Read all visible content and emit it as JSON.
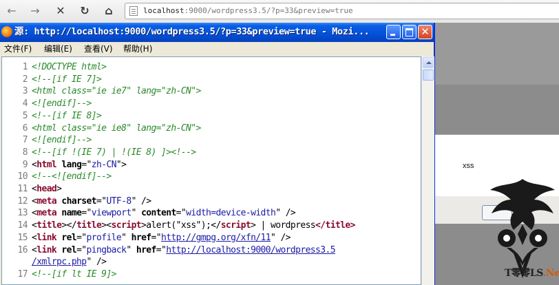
{
  "browser": {
    "url_host": "localhost",
    "url_rest": ":9000/wordpress3.5/?p=33&preview=true"
  },
  "source_window": {
    "title": "源: http://localhost:9000/wordpress3.5/?p=33&preview=true - Mozi...",
    "menu": [
      "文件(F)",
      "编辑(E)",
      "查看(V)",
      "帮助(H)"
    ]
  },
  "source_lines": [
    [
      {
        "c": "cm",
        "t": "<!DOCTYPE html>"
      }
    ],
    [
      {
        "c": "cm",
        "t": "<!--[if IE 7]>"
      }
    ],
    [
      {
        "c": "cm",
        "t": "<html class=\"ie ie7\" lang=\"zh-CN\">"
      }
    ],
    [
      {
        "c": "cm",
        "t": "<![endif]-->"
      }
    ],
    [
      {
        "c": "cm",
        "t": "<!--[if IE 8]>"
      }
    ],
    [
      {
        "c": "cm",
        "t": "<html class=\"ie ie8\" lang=\"zh-CN\">"
      }
    ],
    [
      {
        "c": "cm",
        "t": "<![endif]-->"
      }
    ],
    [
      {
        "c": "cm",
        "t": "<!--[if !(IE 7) | !(IE 8)  ]><!-->"
      }
    ],
    [
      {
        "c": "tg",
        "t": "<"
      },
      {
        "c": "tn",
        "t": "html"
      },
      {
        "c": "tx",
        "t": " "
      },
      {
        "c": "an",
        "t": "lang"
      },
      {
        "c": "tx",
        "t": "=\""
      },
      {
        "c": "av",
        "t": "zh-CN"
      },
      {
        "c": "tx",
        "t": "\">"
      }
    ],
    [
      {
        "c": "cm",
        "t": "<!--<![endif]-->"
      }
    ],
    [
      {
        "c": "tg",
        "t": "<"
      },
      {
        "c": "tn",
        "t": "head"
      },
      {
        "c": "tg",
        "t": ">"
      }
    ],
    [
      {
        "c": "tg",
        "t": "<"
      },
      {
        "c": "tn",
        "t": "meta"
      },
      {
        "c": "tx",
        "t": " "
      },
      {
        "c": "an",
        "t": "charset"
      },
      {
        "c": "tx",
        "t": "=\""
      },
      {
        "c": "av",
        "t": "UTF-8"
      },
      {
        "c": "tx",
        "t": "\" />"
      }
    ],
    [
      {
        "c": "tg",
        "t": "<"
      },
      {
        "c": "tn",
        "t": "meta"
      },
      {
        "c": "tx",
        "t": " "
      },
      {
        "c": "an",
        "t": "name"
      },
      {
        "c": "tx",
        "t": "=\""
      },
      {
        "c": "av",
        "t": "viewport"
      },
      {
        "c": "tx",
        "t": "\" "
      },
      {
        "c": "an",
        "t": "content"
      },
      {
        "c": "tx",
        "t": "=\""
      },
      {
        "c": "av",
        "t": "width=device-width"
      },
      {
        "c": "tx",
        "t": "\" />"
      }
    ],
    [
      {
        "c": "tg",
        "t": "<"
      },
      {
        "c": "tn",
        "t": "title"
      },
      {
        "c": "tg",
        "t": "></"
      },
      {
        "c": "tn",
        "t": "title"
      },
      {
        "c": "tg",
        "t": "><"
      },
      {
        "c": "tn",
        "t": "script"
      },
      {
        "c": "tg",
        "t": ">"
      },
      {
        "c": "tx",
        "t": "alert(\"xss\");"
      },
      {
        "c": "tg",
        "t": "</"
      },
      {
        "c": "tn",
        "t": "script"
      },
      {
        "c": "tg",
        "t": ">"
      },
      {
        "c": "tx",
        "t": " | wordpress"
      },
      {
        "c": "tn",
        "t": "</title>"
      }
    ],
    [
      {
        "c": "tg",
        "t": "<"
      },
      {
        "c": "tn",
        "t": "link"
      },
      {
        "c": "tx",
        "t": " "
      },
      {
        "c": "an",
        "t": "rel"
      },
      {
        "c": "tx",
        "t": "=\""
      },
      {
        "c": "av",
        "t": "profile"
      },
      {
        "c": "tx",
        "t": "\" "
      },
      {
        "c": "an",
        "t": "href"
      },
      {
        "c": "tx",
        "t": "=\""
      },
      {
        "c": "lk",
        "t": "http://gmpg.org/xfn/11"
      },
      {
        "c": "tx",
        "t": "\" />"
      }
    ],
    [
      {
        "c": "tg",
        "t": "<"
      },
      {
        "c": "tn",
        "t": "link"
      },
      {
        "c": "tx",
        "t": " "
      },
      {
        "c": "an",
        "t": "rel"
      },
      {
        "c": "tx",
        "t": "=\""
      },
      {
        "c": "av",
        "t": "pingback"
      },
      {
        "c": "tx",
        "t": "\" "
      },
      {
        "c": "an",
        "t": "href"
      },
      {
        "c": "tx",
        "t": "=\""
      },
      {
        "c": "lk",
        "t": "http://localhost:9000/wordpress3.5"
      }
    ],
    [
      {
        "c": "lk",
        "t": "/xmlrpc.php"
      },
      {
        "c": "tx",
        "t": "\" />"
      }
    ],
    [
      {
        "c": "cm",
        "t": "<!--[if lt IE 9]>"
      }
    ]
  ],
  "line_numbers": [
    "1",
    "2",
    "3",
    "4",
    "5",
    "6",
    "7",
    "8",
    "9",
    "10",
    "11",
    "12",
    "13",
    "14",
    "15",
    "16",
    "",
    "17"
  ],
  "alert": {
    "message": "xss"
  },
  "watermark": {
    "text": "T零零LS",
    "accent": ".Net"
  },
  "colors": {
    "titlebar": "#0453d9",
    "comment": "#2a8a2a",
    "tag_name": "#8a0b2f",
    "attr_value": "#1a1aa6"
  }
}
